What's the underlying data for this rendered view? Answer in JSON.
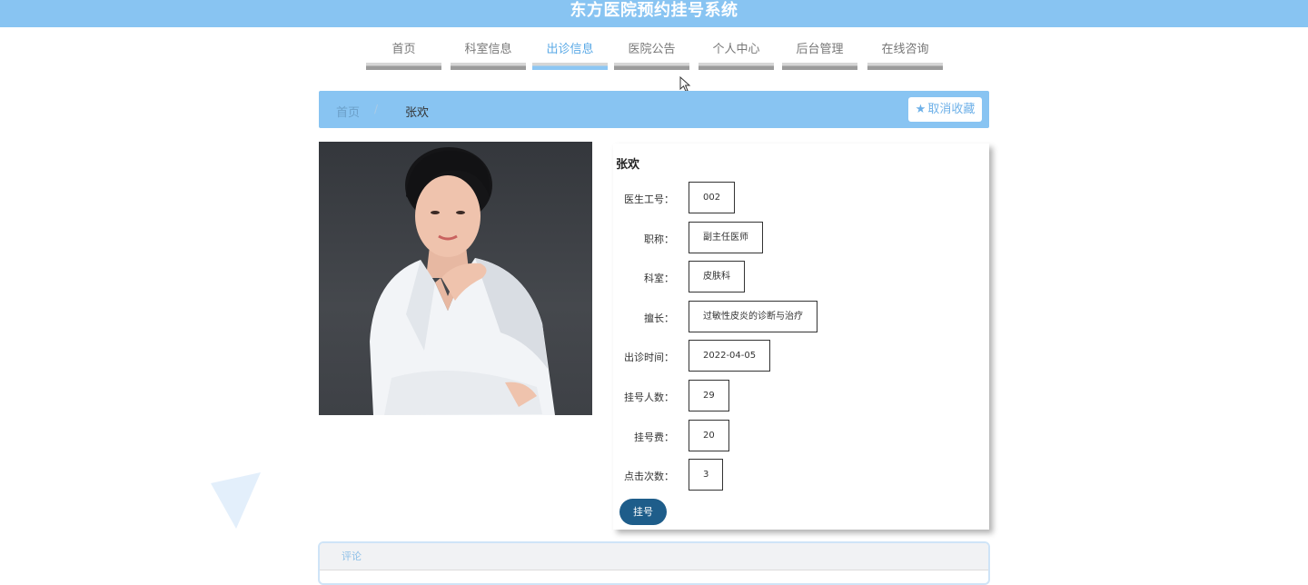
{
  "app": {
    "title": "东方医院预约挂号系统"
  },
  "nav": {
    "items": [
      {
        "label": "首页"
      },
      {
        "label": "科室信息"
      },
      {
        "label": "出诊信息"
      },
      {
        "label": "医院公告"
      },
      {
        "label": "个人中心"
      },
      {
        "label": "后台管理"
      },
      {
        "label": "在线咨询"
      }
    ],
    "active": "出诊信息"
  },
  "breadcrumb": {
    "home": "首页",
    "separator": "/",
    "current": "张欢"
  },
  "actions": {
    "unfavorite_label": "取消收藏",
    "unfavorite_icon": "star-icon"
  },
  "doctor": {
    "name": "张欢",
    "fields": [
      {
        "label": "医生工号：",
        "value": "002"
      },
      {
        "label": "职称：",
        "value": "副主任医师"
      },
      {
        "label": "科室：",
        "value": "皮肤科"
      },
      {
        "label": "擅长：",
        "value": "过敏性皮炎的诊断与治疗"
      },
      {
        "label": "出诊时间：",
        "value": "2022-04-05"
      },
      {
        "label": "挂号人数：",
        "value": "29"
      },
      {
        "label": "挂号费：",
        "value": "20"
      },
      {
        "label": "点击次数：",
        "value": "3"
      }
    ],
    "register_label": "挂号"
  },
  "comment": {
    "title": "评论"
  },
  "colors": {
    "header": "#88c4f2",
    "nav_active": "#5aa9e6",
    "register_button": "#1e5d8a"
  }
}
